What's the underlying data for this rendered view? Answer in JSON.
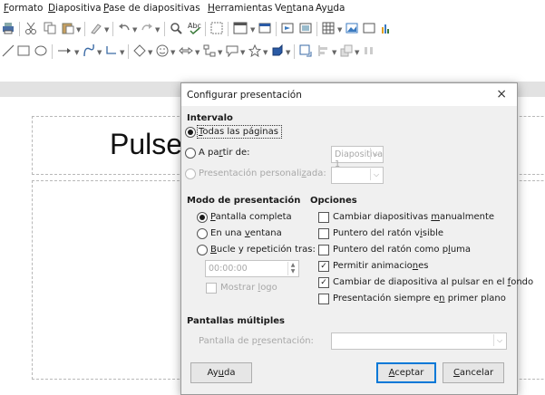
{
  "menu": [
    "Formato",
    "Diapositiva",
    "Pase de diapositivas",
    "Herramientas",
    "Ventana",
    "Ayuda"
  ],
  "slide": {
    "title_text": "Pulse"
  },
  "dialog": {
    "title": "Configurar presentación",
    "close": "×",
    "interval": {
      "heading": "Intervalo",
      "all_slides": "Todas las páginas",
      "from": "A partir de:",
      "from_value": "Diapositiva 1",
      "custom": "Presentación personalizada:",
      "custom_value": "",
      "selected": "all_slides"
    },
    "mode": {
      "heading": "Modo de presentación",
      "full_screen": "Pantalla completa",
      "window": "En una ventana",
      "loop": "Bucle y repetición tras:",
      "loop_time": "00:00:00",
      "show_logo": "Mostrar logo",
      "selected": "full_screen"
    },
    "options": {
      "heading": "Opciones",
      "items": [
        {
          "label": "Cambiar diapositivas manualmente",
          "checked": false
        },
        {
          "label": "Puntero del ratón visible",
          "checked": false
        },
        {
          "label": "Puntero del ratón como pluma",
          "checked": false
        },
        {
          "label": "Permitir animaciones",
          "checked": true
        },
        {
          "label": "Cambiar de diapositiva al pulsar en el fondo",
          "checked": true
        },
        {
          "label": "Presentación siempre en primer plano",
          "checked": false
        }
      ]
    },
    "multi": {
      "heading": "Pantallas múltiples",
      "presentation_display": "Pantalla de presentación:",
      "display_value": ""
    },
    "buttons": {
      "help": "Ayuda",
      "ok": "Aceptar",
      "cancel": "Cancelar"
    }
  },
  "colors": {
    "dialog_bg": "#f0f0f0",
    "default_button_border": "#0078d7",
    "toolbar_strip": "#e2e2e2"
  }
}
